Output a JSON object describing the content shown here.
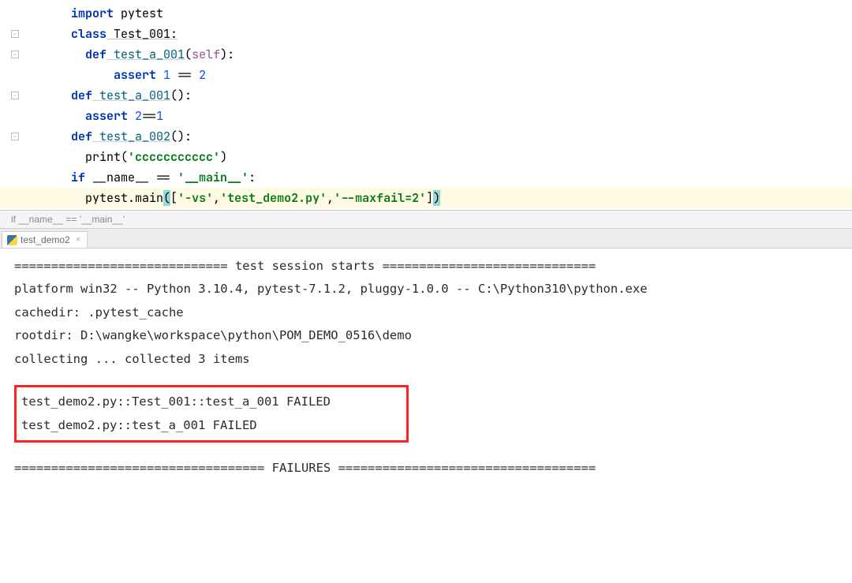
{
  "code": {
    "l1_kw": "import",
    "l1_mod": " pytest",
    "l2_kw": "class",
    "l2_name": " Test_001:",
    "l3_kw": "def",
    "l3_name": " test_a_001",
    "l3_open": "(",
    "l3_self": "self",
    "l3_close": "):",
    "l4_kw": "assert",
    "l4_sp1": " ",
    "l4_n1": "1",
    "l4_eq": " == ",
    "l4_n2": "2",
    "l5_kw": "def",
    "l5_name": " test_a_001",
    "l5_parens": "():",
    "l6_kw": "assert",
    "l6_sp": " ",
    "l6_n1": "2",
    "l6_eq": "==",
    "l6_n2": "1",
    "l7_kw": "def",
    "l7_name": " test_a_002",
    "l7_parens": "():",
    "l8_fn": "print",
    "l8_open": "(",
    "l8_str": "'ccccccccccc'",
    "l8_close": ")",
    "l9_if": "if",
    "l9_name": " __name__ == ",
    "l9_str": "'__main__'",
    "l9_colon": ":",
    "l10_mod": "pytest.main",
    "l10_open": "(",
    "l10_brack": "[",
    "l10_s1": "'-vs'",
    "l10_c1": ",",
    "l10_s2": "'test_demo2.py'",
    "l10_c2": ",",
    "l10_s3": "'--maxfail=2'",
    "l10_brack2": "]",
    "l10_close": ")"
  },
  "breadcrumb": "if __name__ == '__main__'",
  "tab": {
    "name": "test_demo2"
  },
  "console": {
    "l1": "============================= test session starts =============================",
    "l2": "platform win32 -- Python 3.10.4, pytest-7.1.2, pluggy-1.0.0 -- C:\\Python310\\python.exe",
    "l3": "cachedir: .pytest_cache",
    "l4": "rootdir: D:\\wangke\\workspace\\python\\POM_DEMO_0516\\demo",
    "l5": "collecting ... collected 3 items",
    "boxed1": "test_demo2.py::Test_001::test_a_001 FAILED",
    "boxed2": "test_demo2.py::test_a_001 FAILED",
    "failures": "================================== FAILURES ==================================="
  }
}
